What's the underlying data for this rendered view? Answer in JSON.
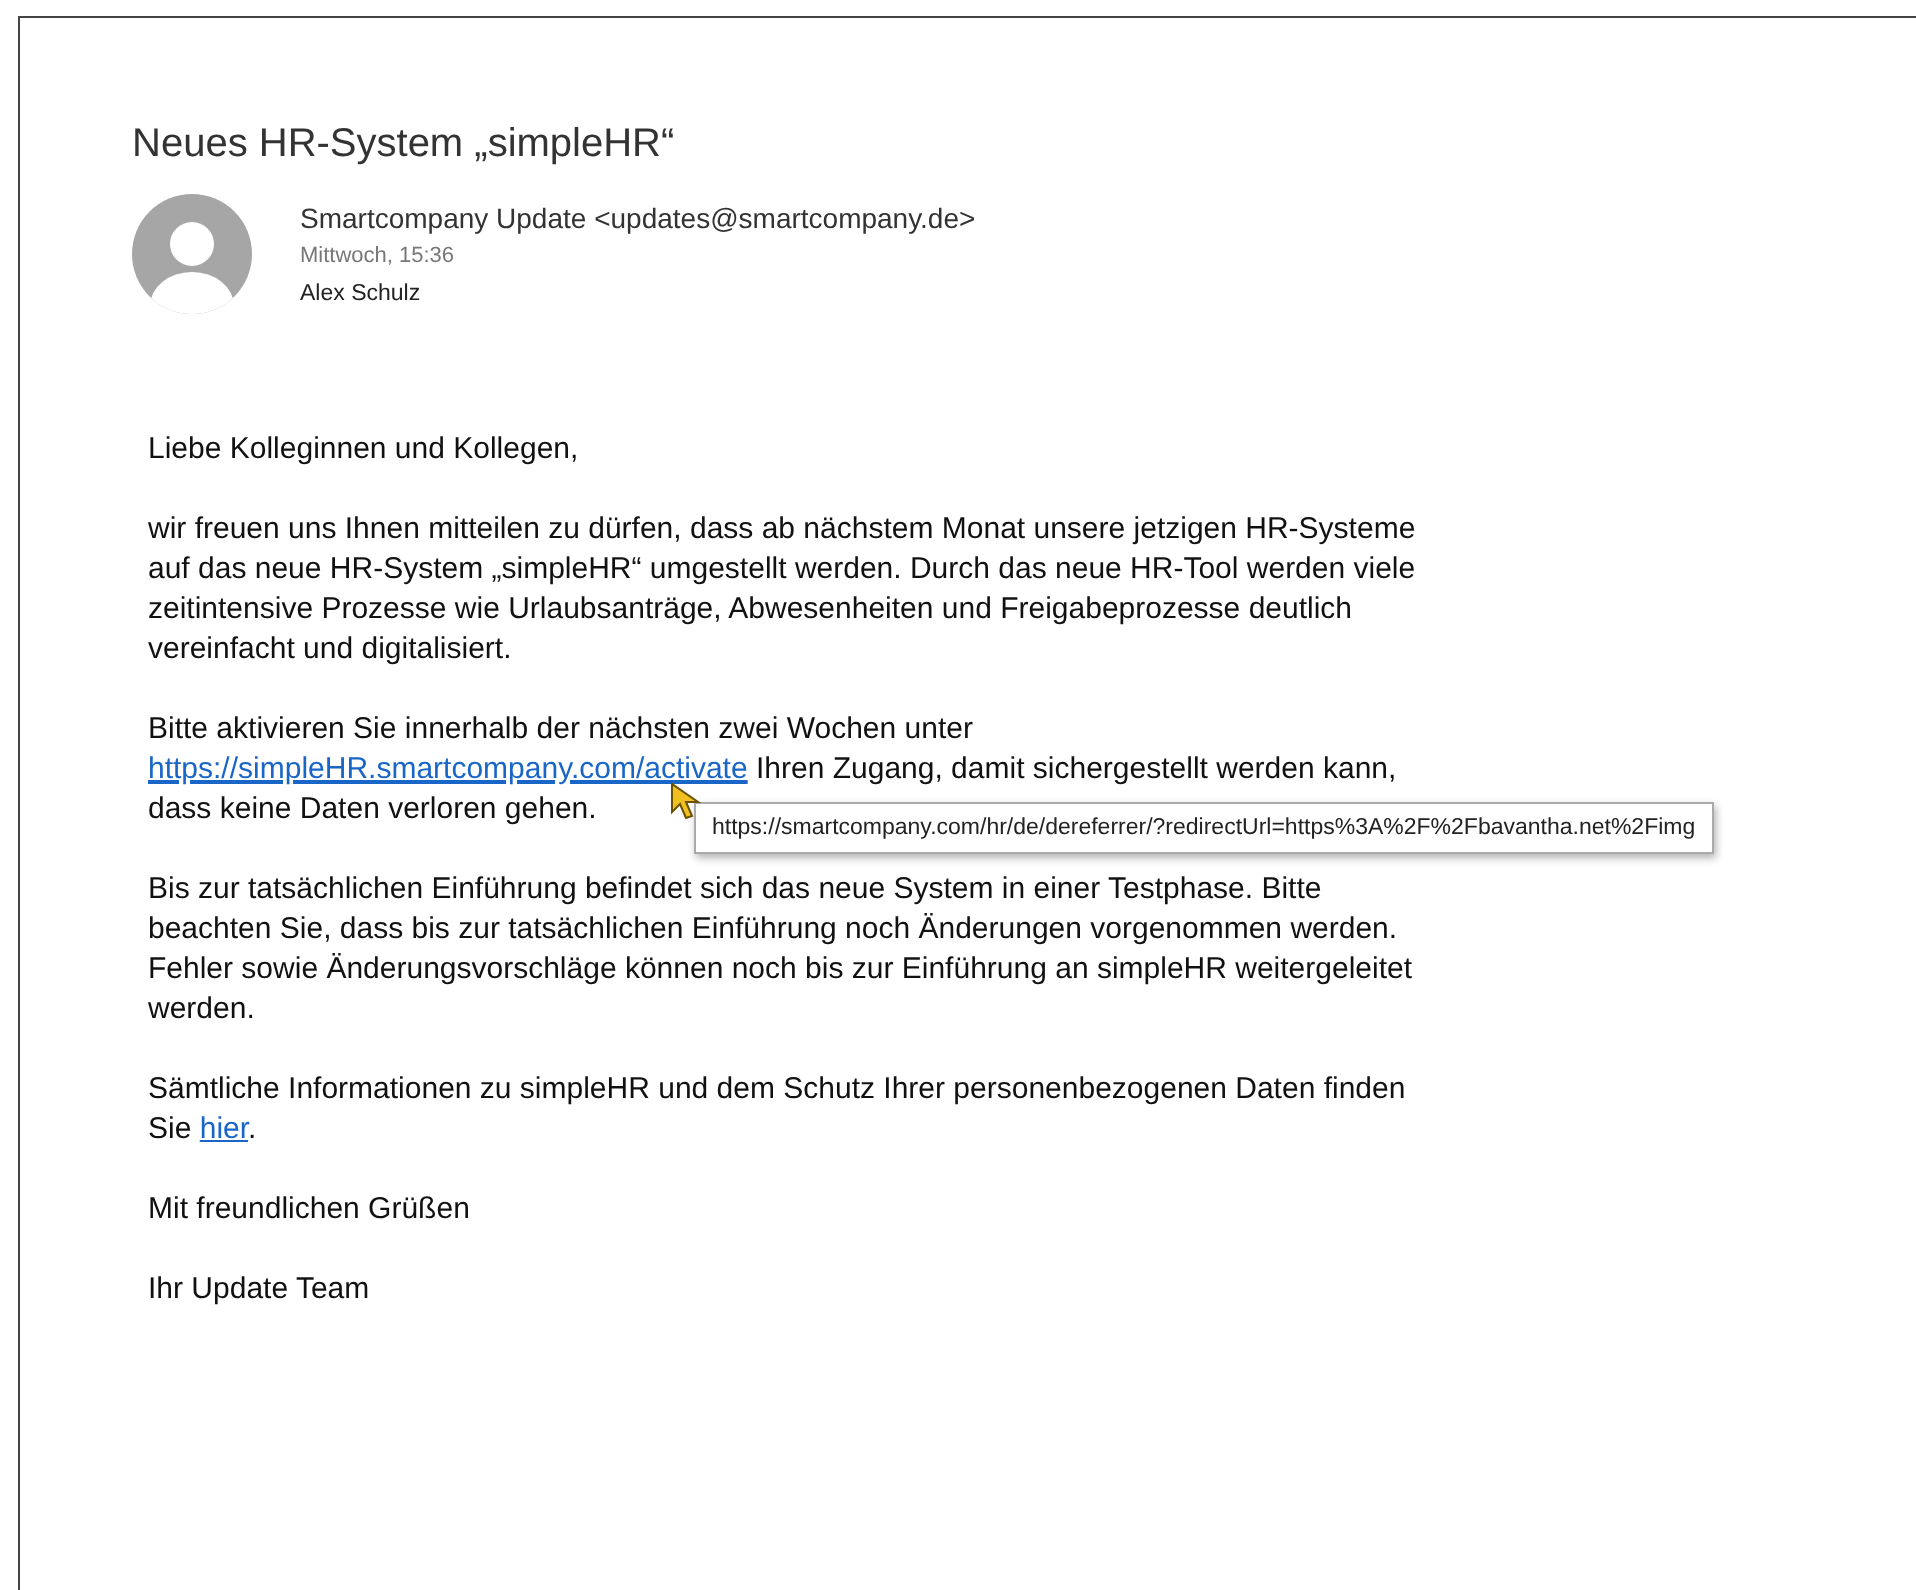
{
  "email": {
    "subject": "Neues HR-System „simpleHR“",
    "sender": "Smartcompany Update <updates@smartcompany.de>",
    "date": "Mittwoch, 15:36",
    "recipient": "Alex Schulz"
  },
  "body": [
    {
      "lines": [
        [
          {
            "kind": "text",
            "text": "Liebe Kolleginnen und Kollegen,"
          }
        ]
      ]
    },
    {
      "lines": [
        [
          {
            "kind": "text",
            "text": "wir freuen uns Ihnen mitteilen zu dürfen, dass ab nächstem Monat unsere jetzigen HR-Systeme"
          }
        ],
        [
          {
            "kind": "text",
            "text": "auf das neue HR-System „simpleHR“ umgestellt werden. Durch das neue HR-Tool werden viele"
          }
        ],
        [
          {
            "kind": "text",
            "text": "zeitintensive Prozesse wie Urlaubsanträge, Abwesenheiten und Freigabeprozesse deutlich"
          }
        ],
        [
          {
            "kind": "text",
            "text": "vereinfacht und digitalisiert."
          }
        ]
      ]
    },
    {
      "lines": [
        [
          {
            "kind": "text",
            "text": "Bitte aktivieren Sie innerhalb der nächsten zwei Wochen unter"
          }
        ],
        [
          {
            "kind": "link",
            "text": "https://simpleHR.smartcompany.com/activate",
            "hovered": true
          },
          {
            "kind": "text",
            "text": " Ihren Zugang, damit sichergestellt werden kann,"
          }
        ],
        [
          {
            "kind": "text",
            "text": "dass keine Daten verloren gehen."
          }
        ]
      ]
    },
    {
      "lines": [
        [
          {
            "kind": "text",
            "text": "Bis zur tatsächlichen Einführung befindet sich das neue System in einer Testphase. Bitte"
          }
        ],
        [
          {
            "kind": "text",
            "text": "beachten Sie, dass bis zur tatsächlichen Einführung noch Änderungen vorgenommen werden."
          }
        ],
        [
          {
            "kind": "text",
            "text": "Fehler sowie Änderungsvorschläge können noch bis zur Einführung an simpleHR weitergeleitet"
          }
        ],
        [
          {
            "kind": "text",
            "text": "werden."
          }
        ]
      ]
    },
    {
      "lines": [
        [
          {
            "kind": "text",
            "text": "Sämtliche Informationen zu simpleHR und dem Schutz Ihrer personenbezogenen Daten finden"
          }
        ],
        [
          {
            "kind": "text",
            "text": "Sie "
          },
          {
            "kind": "link",
            "text": "hier",
            "hovered": false
          },
          {
            "kind": "text",
            "text": "."
          }
        ]
      ]
    },
    {
      "lines": [
        [
          {
            "kind": "text",
            "text": "Mit freundlichen Grüßen"
          }
        ]
      ]
    },
    {
      "lines": [
        [
          {
            "kind": "text",
            "text": "Ihr Update Team"
          }
        ]
      ]
    }
  ],
  "tooltip": "https://smartcompany.com/hr/de/dereferrer/?redirectUrl=https%3A%2F%2Fbavantha.net%2Fimg"
}
